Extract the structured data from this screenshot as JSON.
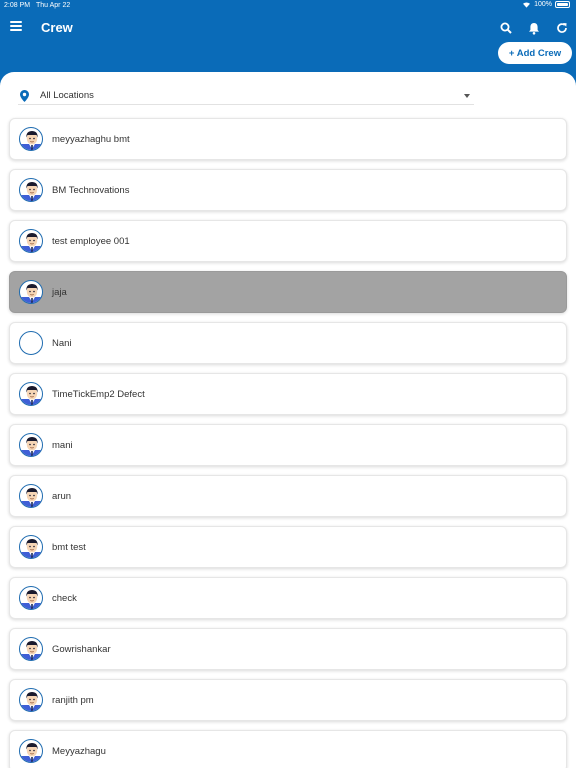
{
  "status": {
    "time": "2:08 PM",
    "date": "Thu Apr 22",
    "battery": "100%"
  },
  "header": {
    "title": "Crew",
    "add_crew_label": "+ Add Crew"
  },
  "filter": {
    "location": "All Locations"
  },
  "crew": [
    {
      "name": "meyyazhaghu bmt",
      "has_photo": true,
      "selected": false
    },
    {
      "name": "BM Technovations",
      "has_photo": true,
      "selected": false
    },
    {
      "name": "test employee 001",
      "has_photo": true,
      "selected": false
    },
    {
      "name": "jaja",
      "has_photo": true,
      "selected": true
    },
    {
      "name": "Nani",
      "has_photo": false,
      "selected": false
    },
    {
      "name": "TimeTickEmp2 Defect",
      "has_photo": true,
      "selected": false
    },
    {
      "name": "mani",
      "has_photo": true,
      "selected": false
    },
    {
      "name": "arun",
      "has_photo": true,
      "selected": false
    },
    {
      "name": "bmt test",
      "has_photo": true,
      "selected": false
    },
    {
      "name": "check",
      "has_photo": true,
      "selected": false
    },
    {
      "name": "Gowrishankar",
      "has_photo": true,
      "selected": false
    },
    {
      "name": "ranjith pm",
      "has_photo": true,
      "selected": false
    },
    {
      "name": "Meyyazhagu",
      "has_photo": true,
      "selected": false
    }
  ],
  "colors": {
    "primary": "#0a6bb8",
    "selected_row": "#a3a3a3"
  }
}
